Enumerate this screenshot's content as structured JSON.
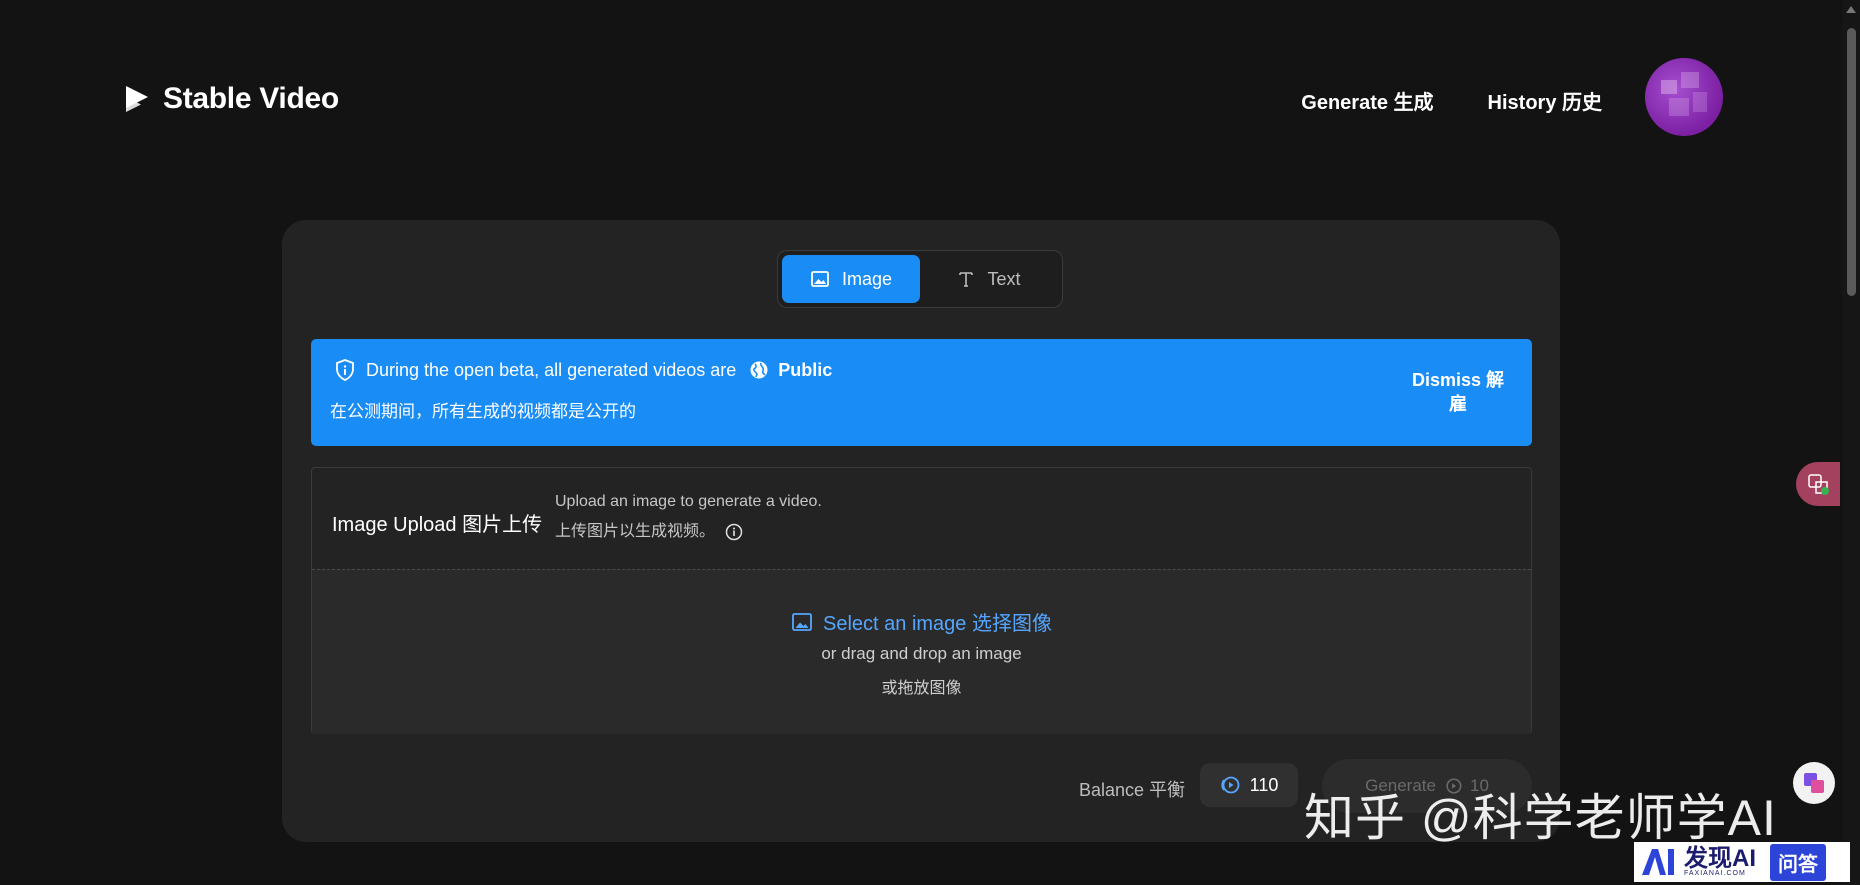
{
  "app": {
    "title": "Stable Video",
    "nav": [
      {
        "label": "Generate 生成"
      },
      {
        "label": "History 历史"
      }
    ]
  },
  "mode_toggle": {
    "image_label": "Image",
    "text_label": "Text",
    "selected": "Image"
  },
  "banner": {
    "line1_text": "During the open beta, all generated videos are",
    "public_label": "Public",
    "line2_text": "在公测期间，所有生成的视频都是公开的",
    "dismiss_label": "Dismiss 解雇"
  },
  "upload": {
    "label": "Image Upload 图片上传",
    "desc_en": "Upload an image to generate a video.",
    "desc_cn": "上传图片以生成视频。",
    "select_label": "Select an image 选择图像",
    "drag_label": "or drag and drop an image",
    "drag_label_cn": "或拖放图像"
  },
  "footer": {
    "balance_label": "Balance 平衡",
    "balance_value": "110",
    "generate_label": "Generate",
    "generate_cost": "10"
  },
  "watermarks": {
    "zhihu": "知乎 @科学老师学AI",
    "brand": "发现AI",
    "brand_sub": "FAXIANAI.COM",
    "ask": "问答"
  },
  "colors": {
    "accent": "#1a8cf5",
    "link": "#56a6ff",
    "background": "#131313",
    "card": "#232323"
  }
}
